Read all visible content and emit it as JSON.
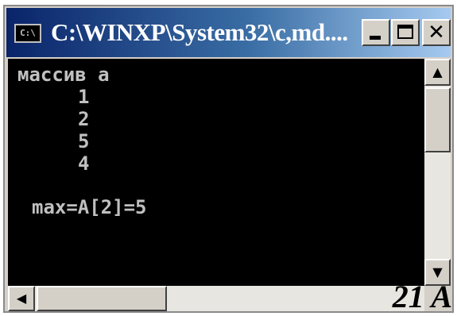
{
  "window": {
    "title": "C:\\WINXP\\System32\\c,md....",
    "icon_text": "C:\\"
  },
  "titlebar_buttons": {
    "minimize_icon": "minimize-icon",
    "maximize_icon": "maximize-icon",
    "close_icon": "close-icon",
    "close_glyph": "✕"
  },
  "console": {
    "header": "массив a",
    "values": [
      "1",
      "2",
      "5",
      "4"
    ],
    "result": "max=A[2]=5",
    "background": "#000000",
    "text_color": "#c0c0c0"
  },
  "scrollbars": {
    "up_arrow": "▲",
    "down_arrow": "▼",
    "left_arrow": "◀"
  },
  "corner_label": "21 A",
  "colors": {
    "titlebar_start": "#0a246a",
    "titlebar_end": "#a6caf0",
    "chrome": "#d4d0c8"
  }
}
